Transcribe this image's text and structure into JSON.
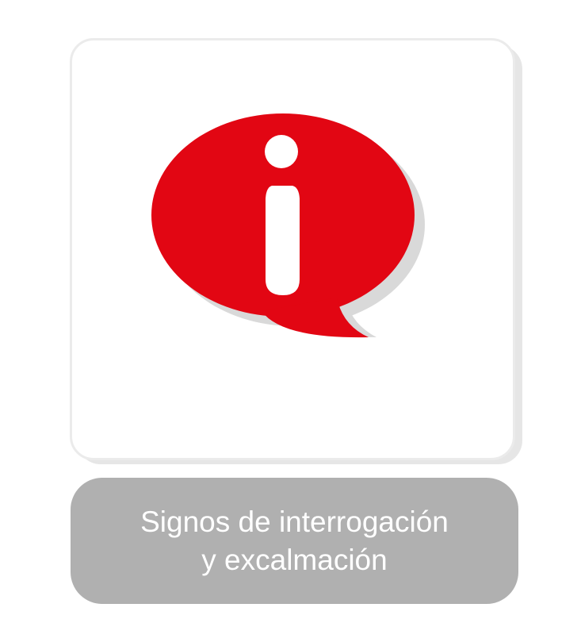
{
  "card": {
    "icon": "info-speech-bubble-icon",
    "colors": {
      "bubble": "#e20613",
      "bubble_shadow": "#d9d9d9",
      "glyph": "#ffffff",
      "card_border": "#ebebeb",
      "label_background": "#b0b0b0",
      "label_text": "#ffffff"
    }
  },
  "label": {
    "line1": "Signos de interrogación",
    "line2": "y excalmación"
  }
}
